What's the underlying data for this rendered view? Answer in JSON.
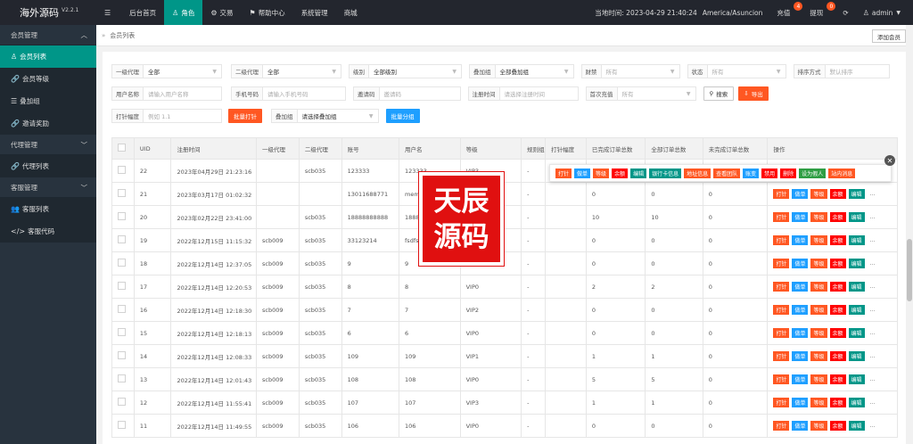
{
  "brand": {
    "title": "海外源码",
    "version": "V2.2.1"
  },
  "nav": [
    {
      "label": "后台首页"
    },
    {
      "label": "角色"
    },
    {
      "label": "交易"
    },
    {
      "label": "帮助中心"
    },
    {
      "label": "系统管理"
    },
    {
      "label": "商城"
    }
  ],
  "top_right": {
    "time": "当地时间: 2023-04-29 21:40:24",
    "tz": "America/Asuncion",
    "recharge": "充值",
    "recharge_count": "4",
    "withdraw": "提现",
    "withdraw_count": "0",
    "user": "admin"
  },
  "sidebar": {
    "groups": [
      {
        "label": "会员管理",
        "items": [
          {
            "label": "会员列表"
          },
          {
            "label": "会员等级"
          },
          {
            "label": "叠加组"
          },
          {
            "label": "邀请奖励"
          }
        ]
      },
      {
        "label": "代理管理",
        "items": [
          {
            "label": "代理列表"
          }
        ]
      },
      {
        "label": "客服管理",
        "items": [
          {
            "label": "客服列表"
          },
          {
            "label": "客服代码"
          }
        ]
      }
    ]
  },
  "breadcrumb": "会员列表",
  "add_member": "添加会员",
  "filters": {
    "level1": {
      "label": "一级代理",
      "value": "全部"
    },
    "level2": {
      "label": "二级代理",
      "value": "全部"
    },
    "grade": {
      "label": "级别",
      "value": "全部级别"
    },
    "overlay": {
      "label": "叠加组",
      "value": "全部叠加组"
    },
    "wealth": {
      "label": "财禁",
      "value": "所有"
    },
    "status": {
      "label": "状态",
      "value": "所有"
    },
    "sort": {
      "label": "排序方式",
      "value": "默认排序"
    },
    "username": {
      "label": "用户名称",
      "placeholder": "请输入用户名称"
    },
    "phone": {
      "label": "手机号码",
      "placeholder": "请输入手机号码"
    },
    "invite": {
      "label": "邀请码",
      "placeholder": "邀请码"
    },
    "regtime": {
      "label": "注册时间",
      "placeholder": "请选择注册时间"
    },
    "first": {
      "label": "首次充值",
      "value": "所有"
    },
    "search": "搜索",
    "export": "导出",
    "punch": {
      "label": "打针幅度",
      "placeholder": "例如 1.1"
    },
    "batch_punch": "批量打针",
    "overlay2": {
      "label": "叠加组",
      "value": "请选择叠加组"
    },
    "batch_group": "批量分组"
  },
  "columns": [
    "UID",
    "注册时间",
    "一级代理",
    "二级代理",
    "账号",
    "用户名",
    "等级",
    "规则组",
    "打针幅度",
    "已完成订单总数",
    "全部订单总数",
    "未完成订单总数",
    "操作"
  ],
  "rows": [
    {
      "uid": "22",
      "time": "2023年04月29日 21:23:16",
      "a1": "",
      "a2": "scb035",
      "acc": "123333",
      "name": "123333",
      "lv": "VIP3",
      "rule": "-",
      "d": "",
      "n1": "0",
      "n2": "",
      "n3": "0"
    },
    {
      "uid": "21",
      "time": "2023年03月17日 01:02:32",
      "a1": "",
      "a2": "",
      "acc": "13011688771",
      "name": "memodian",
      "lv": "VIP0",
      "rule": "-",
      "d": "",
      "n1": "0",
      "n2": "0",
      "n3": "0"
    },
    {
      "uid": "20",
      "time": "2023年02月22日 23:41:00",
      "a1": "",
      "a2": "scb035",
      "acc": "18888888888",
      "name": "18888888888",
      "lv": "VIP0",
      "rule": "-",
      "d": "",
      "n1": "10",
      "n2": "10",
      "n3": "0"
    },
    {
      "uid": "19",
      "time": "2022年12月15日 11:15:32",
      "a1": "scb009",
      "a2": "scb035",
      "acc": "33123214",
      "name": "fsdfsd",
      "lv": "VIP0",
      "rule": "-",
      "d": "",
      "n1": "0",
      "n2": "0",
      "n3": "0"
    },
    {
      "uid": "18",
      "time": "2022年12月14日 12:37:05",
      "a1": "scb009",
      "a2": "scb035",
      "acc": "9",
      "name": "9",
      "lv": "VIP0",
      "rule": "-",
      "d": "",
      "n1": "0",
      "n2": "0",
      "n3": "0"
    },
    {
      "uid": "17",
      "time": "2022年12月14日 12:20:53",
      "a1": "scb009",
      "a2": "scb035",
      "acc": "8",
      "name": "8",
      "lv": "VIP0",
      "rule": "-",
      "d": "",
      "n1": "2",
      "n2": "2",
      "n3": "0"
    },
    {
      "uid": "16",
      "time": "2022年12月14日 12:18:30",
      "a1": "scb009",
      "a2": "scb035",
      "acc": "7",
      "name": "7",
      "lv": "VIP2",
      "rule": "-",
      "d": "",
      "n1": "0",
      "n2": "0",
      "n3": "0"
    },
    {
      "uid": "15",
      "time": "2022年12月14日 12:18:13",
      "a1": "scb009",
      "a2": "scb035",
      "acc": "6",
      "name": "6",
      "lv": "VIP0",
      "rule": "-",
      "d": "",
      "n1": "0",
      "n2": "0",
      "n3": "0"
    },
    {
      "uid": "14",
      "time": "2022年12月14日 12:08:33",
      "a1": "scb009",
      "a2": "scb035",
      "acc": "109",
      "name": "109",
      "lv": "VIP1",
      "rule": "-",
      "d": "",
      "n1": "1",
      "n2": "1",
      "n3": "0"
    },
    {
      "uid": "13",
      "time": "2022年12月14日 12:01:43",
      "a1": "scb009",
      "a2": "scb035",
      "acc": "108",
      "name": "108",
      "lv": "VIP0",
      "rule": "-",
      "d": "",
      "n1": "5",
      "n2": "5",
      "n3": "0"
    },
    {
      "uid": "12",
      "time": "2022年12月14日 11:55:41",
      "a1": "scb009",
      "a2": "scb035",
      "acc": "107",
      "name": "107",
      "lv": "VIP3",
      "rule": "-",
      "d": "",
      "n1": "1",
      "n2": "1",
      "n3": "0"
    },
    {
      "uid": "11",
      "time": "2022年12月14日 11:49:55",
      "a1": "scb009",
      "a2": "scb035",
      "acc": "106",
      "name": "106",
      "lv": "VIP0",
      "rule": "-",
      "d": "",
      "n1": "0",
      "n2": "0",
      "n3": "0"
    }
  ],
  "row_ops": [
    "打针",
    "做单",
    "等级",
    "余额",
    "编辑",
    "..."
  ],
  "popup_ops": [
    {
      "label": "打针",
      "color": "#ff5722"
    },
    {
      "label": "做单",
      "color": "#1e9fff"
    },
    {
      "label": "等级",
      "color": "#ff5722"
    },
    {
      "label": "余额",
      "color": "#ff0000"
    },
    {
      "label": "编辑",
      "color": "#009688"
    },
    {
      "label": "银行卡信息",
      "color": "#009688"
    },
    {
      "label": "地址信息",
      "color": "#ff5722"
    },
    {
      "label": "查看团队",
      "color": "#ff5722"
    },
    {
      "label": "账变",
      "color": "#1e9fff"
    },
    {
      "label": "禁用",
      "color": "#ff0000"
    },
    {
      "label": "删除",
      "color": "#ff0000"
    },
    {
      "label": "设为假人",
      "color": "#2f9e44"
    },
    {
      "label": "站内消息",
      "color": "#ff5722"
    }
  ],
  "watermark": [
    "天辰",
    "源码"
  ]
}
